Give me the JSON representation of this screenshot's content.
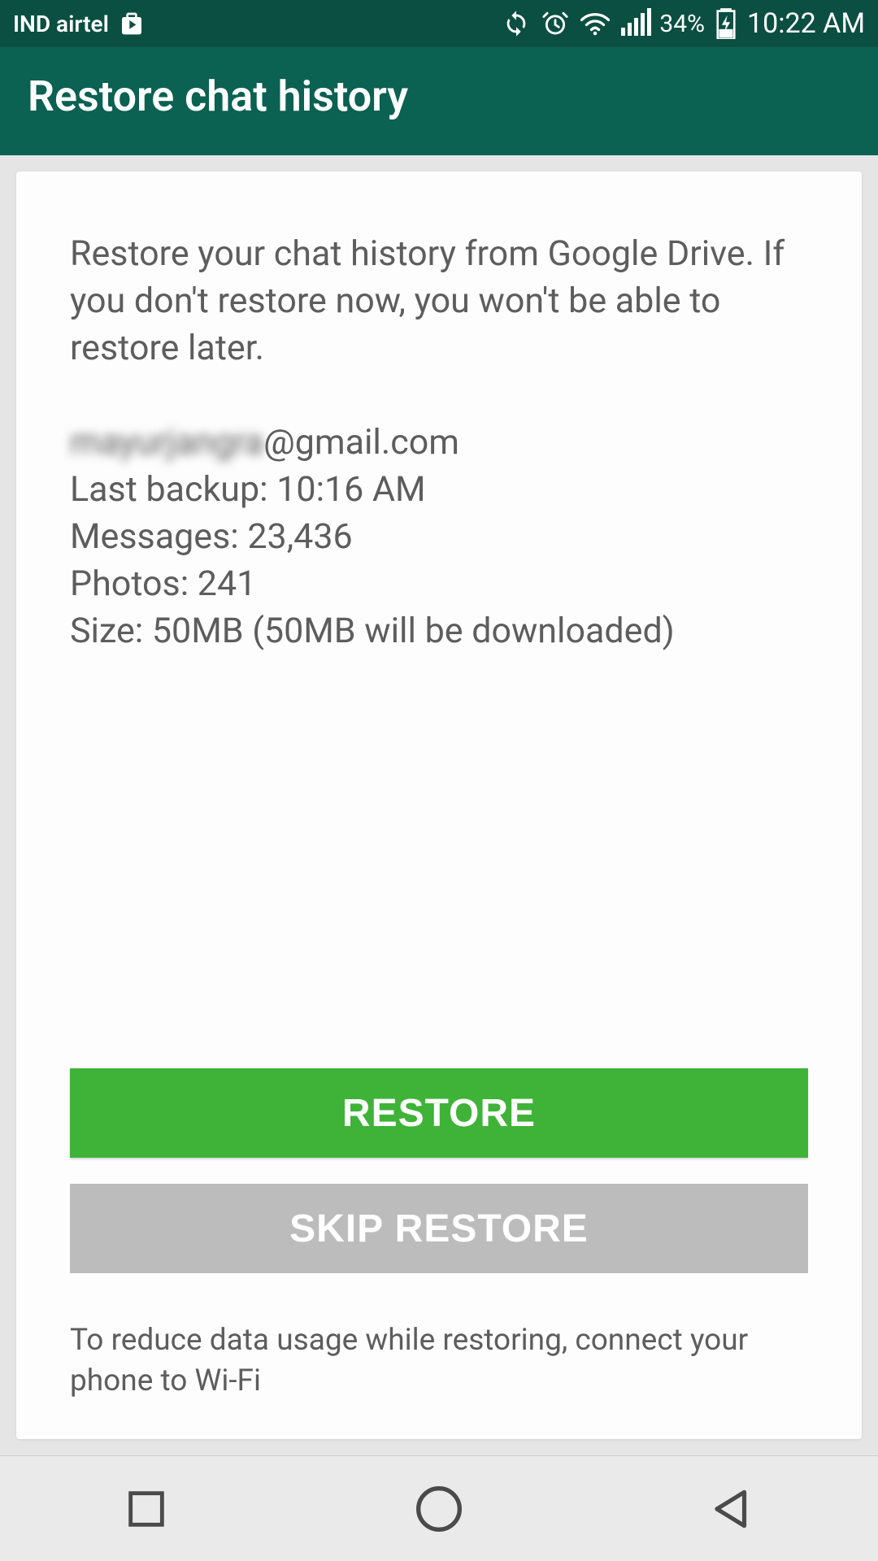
{
  "status_bar": {
    "carrier": "IND airtel",
    "battery_pct": "34%",
    "time": "10:22 AM"
  },
  "app_bar": {
    "title": "Restore chat history"
  },
  "card": {
    "intro": "Restore your chat history from Google Drive. If you don't restore now, you won't be able to restore later.",
    "email_redacted": "mayurjangra",
    "email_domain": "@gmail.com",
    "last_backup_label": "Last backup:",
    "last_backup_value": "10:16 AM",
    "messages_label": "Messages:",
    "messages_value": "23,436",
    "photos_label": "Photos:",
    "photos_value": "241",
    "size_label": "Size:",
    "size_value": "50MB (50MB will be downloaded)",
    "restore_label": "RESTORE",
    "skip_label": "SKIP RESTORE",
    "footer_note": "To reduce data usage while restoring, connect your phone to Wi-Fi"
  }
}
